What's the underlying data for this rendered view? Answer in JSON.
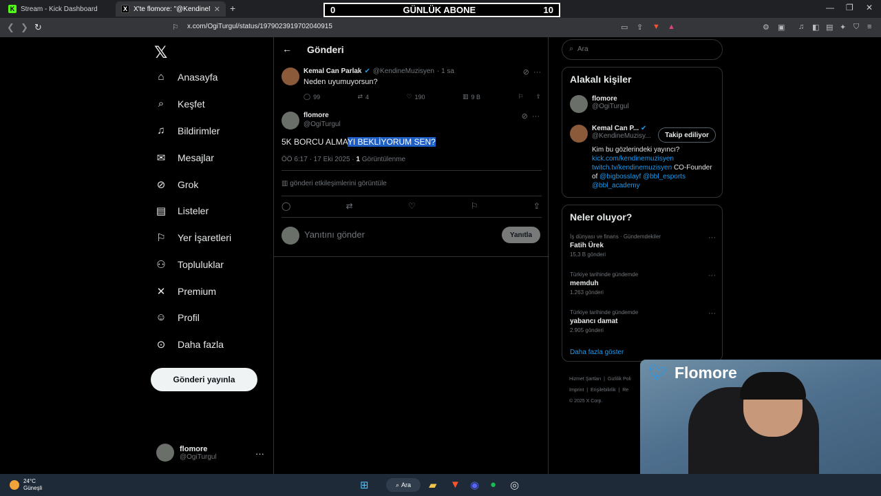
{
  "browser": {
    "tabs": [
      {
        "title": "Stream - Kick Dashboard",
        "icon": "kick-icon"
      },
      {
        "title": "X'te flomore: \"@KendineMuzisyen...",
        "icon": "x-icon"
      }
    ],
    "url": "x.com/OgiTurgul/status/1979023919702040915"
  },
  "overlay": {
    "left": "0",
    "center": "GÜNLÜK ABONE",
    "right": "10"
  },
  "nav": {
    "items": [
      "Anasayfa",
      "Keşfet",
      "Bildirimler",
      "Mesajlar",
      "Grok",
      "Listeler",
      "Yer İşaretleri",
      "Topluluklar",
      "Premium",
      "Profil",
      "Daha fazla"
    ],
    "post_button": "Gönderi yayınla",
    "profile": {
      "name": "flomore",
      "handle": "@OgiTurgul"
    }
  },
  "main": {
    "header": "Gönderi",
    "parent_tweet": {
      "name": "Kemal Can Parlak",
      "handle": "@KendineMuzisyen",
      "time": "· 1 sa",
      "text": "Neden uyumuyorsun?",
      "replies": "99",
      "retweets": "4",
      "likes": "190",
      "views": "9 B"
    },
    "tweet": {
      "name": "flomore",
      "handle": "@OgiTurgul",
      "text_plain": "5K BORCU ALMA",
      "text_selected": "YI BEKLİYORUM SEN?",
      "meta": "ÖÖ 6:17 · 17 Eki 2025 ·",
      "views_count": "1",
      "views_label": "Görüntülenme",
      "engagement": "gönderi etkileşimlerini görüntüle"
    },
    "reply_placeholder": "Yanıtını gönder",
    "reply_button": "Yanıtla"
  },
  "right": {
    "search_placeholder": "Ara",
    "related_title": "Alakalı kişiler",
    "people": [
      {
        "name": "flomore",
        "handle": "@OgiTurgul"
      },
      {
        "name": "Kemal Can P...",
        "handle": "@KendineMuzisy..."
      }
    ],
    "follow_label": "Takip ediliyor",
    "bio": {
      "line1": "Kim bu gözlerindeki yayıncı?",
      "link1": "kick.com/kendinemuzisyen",
      "link2": "twitch.tv/kendinemuzisyen",
      "text2": " CO-Founder of ",
      "link3": "@bigbosslayf",
      "link4": "@bbl_esports",
      "link5": "@bbl_academy"
    },
    "trends_title": "Neler oluyor?",
    "trends": [
      {
        "context": "İş dünyası ve finans · Gündemdekiler",
        "title": "Fatih Ürek",
        "count": "15,3 B gönderi"
      },
      {
        "context": "Türkiye tarihinde gündemde",
        "title": "memduh",
        "count": "1.263 gönderi"
      },
      {
        "context": "Türkiye tarihinde gündemde",
        "title": "yabancı damat",
        "count": "2.905 gönderi"
      }
    ],
    "show_more": "Daha fazla göster",
    "footer": {
      "l1a": "Hizmet Şartları",
      "l1b": "Gizlilik Poli",
      "l2a": "Imprint",
      "l2b": "Erişilebilirlik",
      "l2c": "Re",
      "l3": "© 2025 X Corp."
    }
  },
  "cam": {
    "name": "Flomore"
  },
  "taskbar": {
    "temp": "24°C",
    "weather": "Güneşli",
    "search": "Ara"
  }
}
